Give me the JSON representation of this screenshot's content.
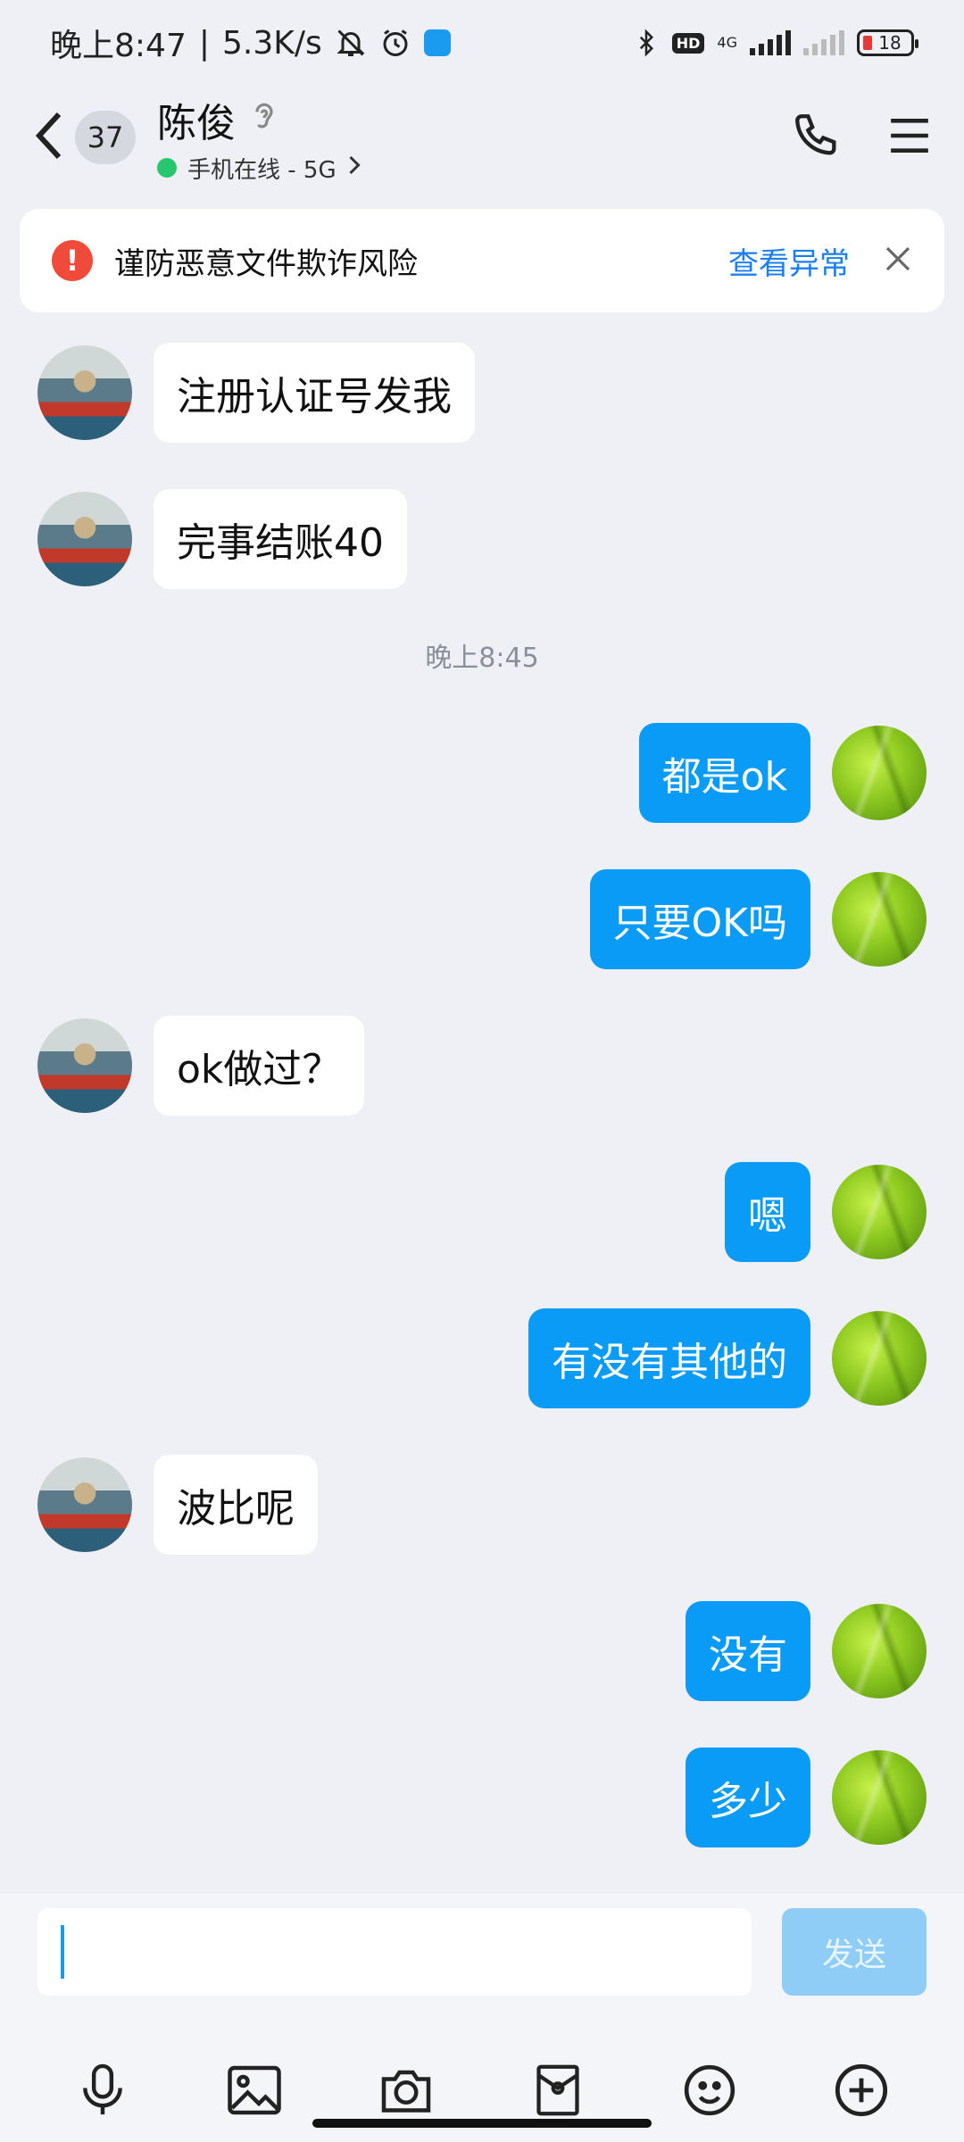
{
  "status_bar": {
    "time": "晚上8:47",
    "net_speed": "5.3K/s",
    "network": "4G",
    "battery": "18"
  },
  "header": {
    "unread_count": "37",
    "contact_name": "陈俊",
    "status": "手机在线 - 5G"
  },
  "warning": {
    "text": "谨防恶意文件欺诈风险",
    "link": "查看异常"
  },
  "messages": [
    {
      "side": "left",
      "text": "注册认证号发我"
    },
    {
      "side": "left",
      "text": "完事结账40"
    },
    {
      "side": "right",
      "text": "都是ok"
    },
    {
      "side": "right",
      "text": "只要OK吗"
    },
    {
      "side": "left",
      "text": "ok做过？"
    },
    {
      "side": "right",
      "text": "嗯"
    },
    {
      "side": "right",
      "text": "有没有其他的"
    },
    {
      "side": "left",
      "text": "波比呢"
    },
    {
      "side": "right",
      "text": "没有"
    },
    {
      "side": "right",
      "text": "多少"
    }
  ],
  "time_separator": "晚上8:45",
  "input": {
    "value": "",
    "send_label": "发送"
  },
  "toolbar": [
    "microphone-icon",
    "image-icon",
    "camera-icon",
    "red-packet-icon",
    "emoji-icon",
    "plus-icon"
  ],
  "colors": {
    "bubble_self": "#0a9bf6",
    "accent_link": "#1b7ff0",
    "warning_red": "#f04a3a",
    "online": "#28c76f"
  }
}
